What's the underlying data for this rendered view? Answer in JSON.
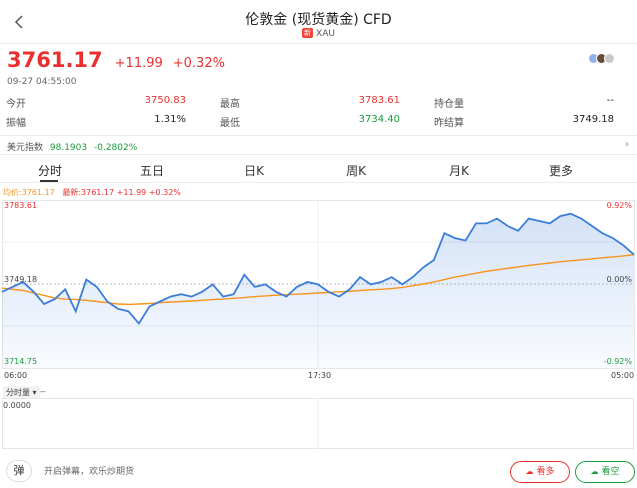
{
  "header": {
    "title": "伦敦金 (现货黄金) CFD",
    "tag": "新",
    "symbol": "XAU"
  },
  "quote": {
    "price": "3761.17",
    "change": "+11.99",
    "change_pct": "+0.32%",
    "datetime": "09-27 04:55:00"
  },
  "stats": {
    "open_label": "今开",
    "open": "3750.83",
    "high_label": "最高",
    "high": "3783.61",
    "position_label": "持仓量",
    "position": "--",
    "amplitude_label": "振幅",
    "amplitude": "1.31%",
    "low_label": "最低",
    "low": "3734.40",
    "prev_settle_label": "昨结算",
    "prev_settle": "3749.18"
  },
  "usd_index": {
    "label": "美元指数",
    "value": "98.1903",
    "change": "-0.2802%"
  },
  "tabs": [
    {
      "label": "分时"
    },
    {
      "label": "五日"
    },
    {
      "label": "日K"
    },
    {
      "label": "周K"
    },
    {
      "label": "月K"
    },
    {
      "label": "更多"
    }
  ],
  "legend": {
    "avg": "均价:3761.17",
    "latest": "最新:3761.17 +11.99 +0.32%"
  },
  "chart_data": {
    "type": "line",
    "title": "",
    "xlabel": "",
    "ylabel": "",
    "ylim": [
      3714.75,
      3783.61
    ],
    "y_ticks_left": [
      "3783.61",
      "3749.18",
      "3714.75"
    ],
    "y_ticks_right": [
      "0.92%",
      "0.00%",
      "-0.92%"
    ],
    "x_ticks": [
      "06:00",
      "17:30",
      "05:00"
    ],
    "x": [
      0,
      1,
      2,
      3,
      4,
      5,
      6,
      7,
      8,
      9,
      10,
      11,
      12,
      13,
      14,
      15,
      16,
      17,
      18,
      19,
      20,
      21,
      22,
      23,
      24,
      25,
      26,
      27,
      28,
      29,
      30,
      31,
      32,
      33,
      34,
      35,
      36,
      37,
      38,
      39,
      40,
      41,
      42,
      43,
      44,
      45,
      46,
      47,
      48,
      49,
      50,
      51,
      52,
      53,
      54,
      55,
      56,
      57,
      58,
      59,
      60
    ],
    "series": [
      {
        "values": [
          3746,
          3748,
          3750,
          3746,
          3741,
          3743,
          3747,
          3738,
          3751,
          3748,
          3742,
          3739,
          3738,
          3733,
          3740,
          3742,
          3744,
          3745,
          3744,
          3746,
          3749,
          3744,
          3745,
          3753,
          3748,
          3749,
          3746,
          3744,
          3748,
          3750,
          3749,
          3746,
          3744,
          3747,
          3752,
          3749,
          3750,
          3752,
          3749,
          3752,
          3756,
          3759,
          3770,
          3768,
          3767,
          3774,
          3774,
          3776,
          3773,
          3771,
          3776,
          3775,
          3774,
          3777,
          3778,
          3776,
          3773,
          3770,
          3768,
          3765,
          3761.17
        ]
      },
      {
        "values": [
          3747.5,
          3747.0,
          3746.5,
          3745.5,
          3744.5,
          3743.5,
          3743.0,
          3742.8,
          3742.5,
          3742.0,
          3741.5,
          3741.0,
          3740.8,
          3741.0,
          3741.2,
          3741.5,
          3741.8,
          3742.0,
          3742.2,
          3742.5,
          3742.8,
          3743.0,
          3743.3,
          3743.6,
          3744.0,
          3744.3,
          3744.6,
          3744.8,
          3745.0,
          3745.2,
          3745.5,
          3745.7,
          3746.0,
          3746.2,
          3746.5,
          3746.8,
          3747.0,
          3747.3,
          3747.8,
          3748.5,
          3749.2,
          3750.0,
          3751.0,
          3752.0,
          3752.8,
          3753.6,
          3754.4,
          3755.0,
          3755.6,
          3756.2,
          3756.8,
          3757.3,
          3757.8,
          3758.3,
          3758.7,
          3759.1,
          3759.5,
          3759.9,
          3760.3,
          3760.7,
          3761.17
        ]
      }
    ],
    "colors": {
      "price": "#3b7ddd",
      "avg": "#f7931e",
      "up": "#e93030",
      "down": "#1a9d3c"
    }
  },
  "volume": {
    "selector": "分时量",
    "value": "--",
    "axis_zero": "0.0000"
  },
  "bottom": {
    "danmu_icon": "弹",
    "hint": "开启弹幕，欢乐炒期货",
    "long_label": "看多",
    "short_label": "看空"
  }
}
